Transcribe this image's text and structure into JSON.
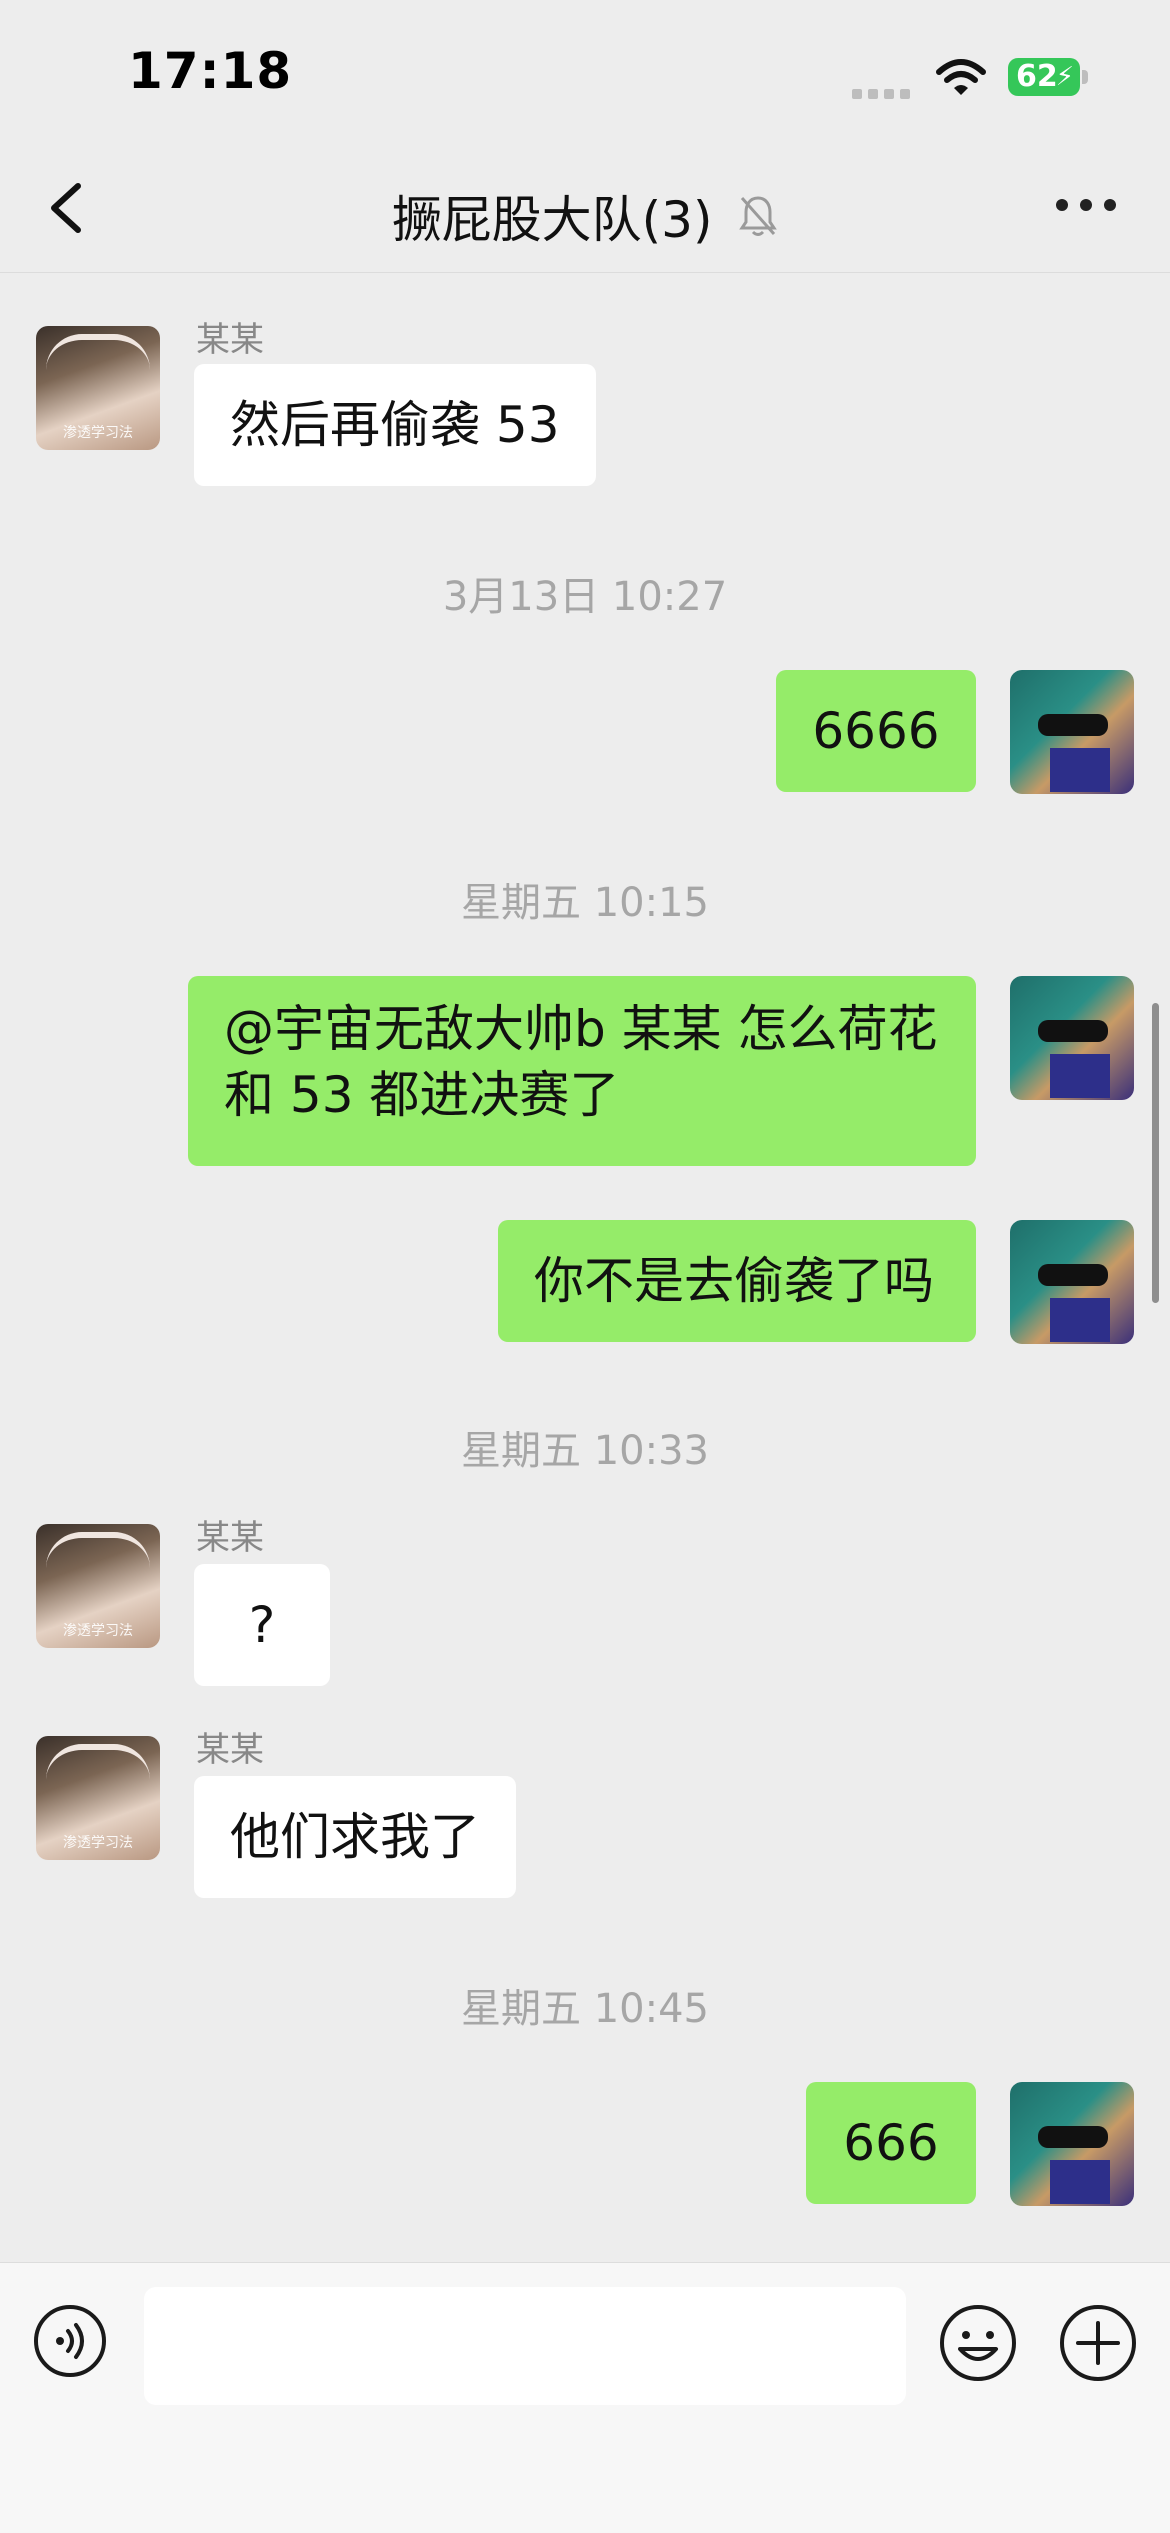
{
  "status_bar": {
    "time": "17:18",
    "battery": "62"
  },
  "nav": {
    "title": "撅屁股大队(3)",
    "muted": true
  },
  "messages": [
    {
      "type": "in",
      "sender": "某某",
      "text": "然后再偷袭 53",
      "avatar_caption": "渗透学习法"
    },
    {
      "type": "time",
      "text": "3月13日 10:27"
    },
    {
      "type": "out",
      "text": "6666"
    },
    {
      "type": "time",
      "text": "星期五 10:15"
    },
    {
      "type": "out",
      "text": "@宇宙无敌大帅b 某某 怎么荷花和 53 都进决赛了"
    },
    {
      "type": "out",
      "text": "你不是去偷袭了吗"
    },
    {
      "type": "time",
      "text": "星期五 10:33"
    },
    {
      "type": "in",
      "sender": "某某",
      "text": "?",
      "avatar_caption": "渗透学习法"
    },
    {
      "type": "in",
      "sender": "某某",
      "text": "他们求我了",
      "avatar_caption": "渗透学习法"
    },
    {
      "type": "time",
      "text": "星期五 10:45"
    },
    {
      "type": "out",
      "text": "666"
    }
  ],
  "input": {
    "value": ""
  },
  "icons": {
    "back": "chevron-left-icon",
    "mute": "bell-slash-icon",
    "more": "ellipsis-icon",
    "voice": "voice-icon",
    "emoji": "emoji-icon",
    "plus": "plus-icon"
  }
}
